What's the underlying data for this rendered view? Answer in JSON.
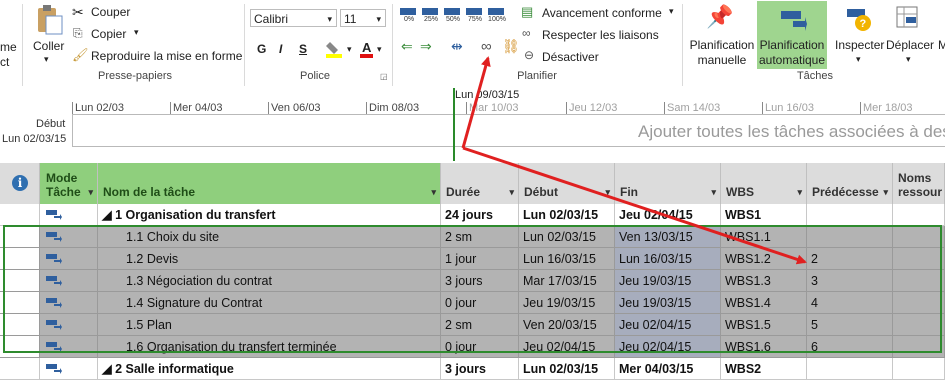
{
  "ribbon": {
    "left_partial": {
      "line1": "me",
      "line2": "ct"
    },
    "coller": "Coller",
    "couper": "Couper",
    "copier": "Copier",
    "reproduire": "Reproduire la mise en forme",
    "group_presse": "Presse-papiers",
    "font_name": "Calibri",
    "font_size": "11",
    "bold": "G",
    "italic": "I",
    "underline": "S",
    "group_police": "Police",
    "pct_labels": [
      "0%",
      "25%",
      "50%",
      "75%",
      "100%"
    ],
    "avancement": "Avancement conforme",
    "respecter": "Respecter les liaisons",
    "desactiver": "Désactiver",
    "group_planifier": "Planifier",
    "plan_manuelle": [
      "Planification",
      "manuelle"
    ],
    "plan_auto": [
      "Planification",
      "automatique"
    ],
    "inspecter": "Inspecter",
    "deplacer": "Déplacer",
    "more": "M",
    "group_taches": "Tâches"
  },
  "timeline": {
    "debut_label": "Début",
    "debut_date": "Lun 02/03/15",
    "today": "Lun 09/03/15",
    "dates": [
      {
        "label": "Lun 02/03",
        "dim": false
      },
      {
        "label": "Mer 04/03",
        "dim": false
      },
      {
        "label": "Ven 06/03",
        "dim": false
      },
      {
        "label": "Dim 08/03",
        "dim": false
      },
      {
        "label": "Mar 10/03",
        "dim": true
      },
      {
        "label": "Jeu 12/03",
        "dim": true
      },
      {
        "label": "Sam 14/03",
        "dim": true
      },
      {
        "label": "Lun 16/03",
        "dim": true
      },
      {
        "label": "Mer 18/03",
        "dim": true
      }
    ],
    "hint": "Ajouter toutes les tâches associées à des da"
  },
  "grid": {
    "headers": {
      "mode": [
        "Mode",
        "Tâche"
      ],
      "name": "Nom de la tâche",
      "duree": "Durée",
      "debut": "Début",
      "fin": "Fin",
      "wbs": "WBS",
      "pred": "Prédécesse",
      "res": [
        "Noms",
        "ressour"
      ]
    },
    "rows": [
      {
        "num": "",
        "name": "◢ 1 Organisation du transfert",
        "duree": "24 jours",
        "debut": "Lun 02/03/15",
        "fin": "Jeu 02/04/15",
        "wbs": "WBS1",
        "pred": "",
        "summary": true,
        "selected": false
      },
      {
        "num": "",
        "name": "1.1 Choix du site",
        "duree": "2 sm",
        "debut": "Lun 02/03/15",
        "fin": "Ven 13/03/15",
        "wbs": "WBS1.1",
        "pred": "",
        "summary": false,
        "selected": true
      },
      {
        "num": "",
        "name": "1.2 Devis",
        "duree": "1 jour",
        "debut": "Lun 16/03/15",
        "fin": "Lun 16/03/15",
        "wbs": "WBS1.2",
        "pred": "2",
        "summary": false,
        "selected": true
      },
      {
        "num": "",
        "name": "1.3 Négociation du contrat",
        "duree": "3 jours",
        "debut": "Mar 17/03/15",
        "fin": "Jeu 19/03/15",
        "wbs": "WBS1.3",
        "pred": "3",
        "summary": false,
        "selected": true
      },
      {
        "num": "",
        "name": "1.4 Signature du Contrat",
        "duree": "0 jour",
        "debut": "Jeu 19/03/15",
        "fin": "Jeu 19/03/15",
        "wbs": "WBS1.4",
        "pred": "4",
        "summary": false,
        "selected": true
      },
      {
        "num": "",
        "name": "1.5 Plan",
        "duree": "2 sm",
        "debut": "Ven 20/03/15",
        "fin": "Jeu 02/04/15",
        "wbs": "WBS1.5",
        "pred": "5",
        "summary": false,
        "selected": true
      },
      {
        "num": "",
        "name": "1.6 Organisation du transfert terminée",
        "duree": "0 jour",
        "debut": "Jeu 02/04/15",
        "fin": "Jeu 02/04/15",
        "wbs": "WBS1.6",
        "pred": "6",
        "summary": false,
        "selected": true
      },
      {
        "num": "",
        "name": "◢ 2 Salle informatique",
        "duree": "3 jours",
        "debut": "Lun 02/03/15",
        "fin": "Mer 04/03/15",
        "wbs": "WBS2",
        "pred": "",
        "summary": true,
        "selected": false
      }
    ]
  },
  "colors": {
    "accent_green": "#8fcf7d",
    "arrow_red": "#e02020",
    "task_icon": "#2f5f9e"
  }
}
